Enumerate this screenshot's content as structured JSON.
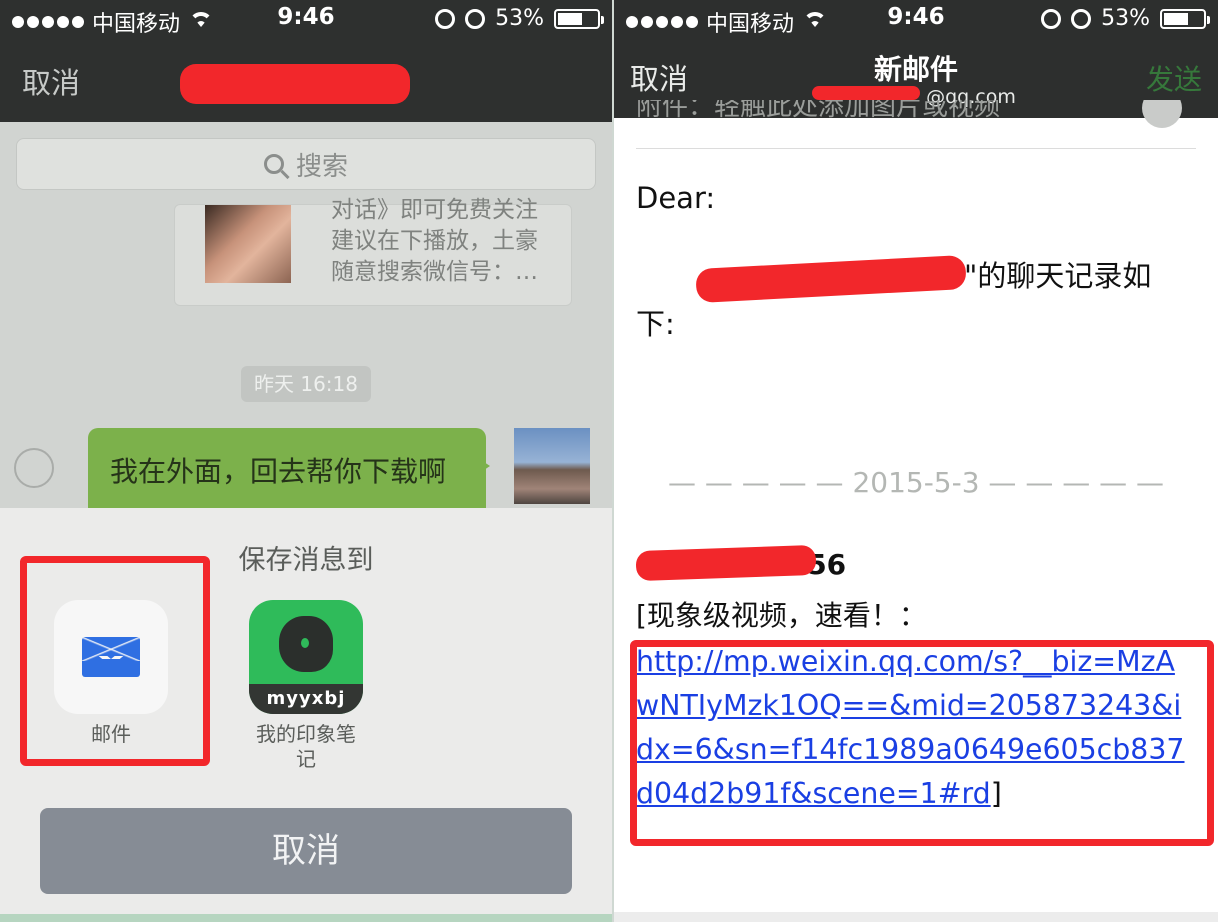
{
  "status": {
    "carrier": "中国移动",
    "time": "9:46",
    "battery": "53%"
  },
  "left": {
    "nav_cancel": "取消",
    "search_placeholder": "搜索",
    "card_text": "对话》即可免费关注 建议在下播放，土豪 随意搜索微信号：…",
    "timestamp": "昨天 16:18",
    "bubble_text": "我在外面，回去帮你下载啊",
    "sheet_title": "保存消息到",
    "apps": [
      {
        "label": "邮件",
        "icon": "mail-icon"
      },
      {
        "label": "我的印象笔记",
        "icon": "evernote-icon",
        "badge": "myyxbj"
      }
    ],
    "cancel_button": "取消"
  },
  "right": {
    "nav_cancel": "取消",
    "title": "新邮件",
    "sender_email": "@qq.com",
    "send_button": "发送",
    "attachment_hint": "附件：轻触此处添加图片或视频",
    "greeting": "Dear:",
    "intro_suffix": "\"的聊天记录如",
    "intro_line2": "下:",
    "date_separator": "— — — — —  2015-5-3  — — — — —",
    "sender_time": ":56",
    "message": "[现象级视频，速看！：",
    "link": "http://mp.weixin.qq.com/s?__biz=MzAwNTIyMzk1OQ==&mid=205873243&idx=6&sn=f14fc1989a0649e605cb837d04d2b91f&scene=1#rd",
    "link_close": "]"
  },
  "colors": {
    "redaction": "#f2272b",
    "wechat_bubble": "#7cb14b",
    "link": "#1a3fe3",
    "send_disabled": "#36783b"
  }
}
